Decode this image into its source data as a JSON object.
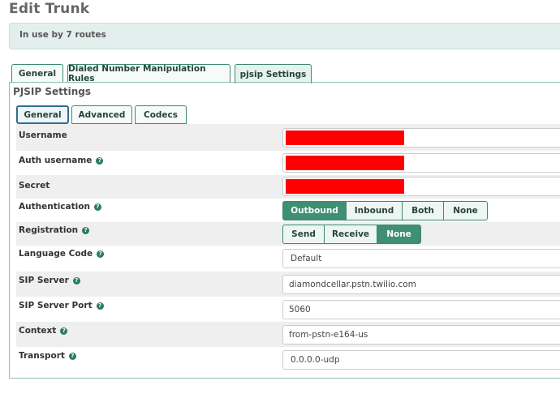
{
  "header": {
    "title": "Edit Trunk"
  },
  "info": {
    "text": "In use by 7 routes"
  },
  "tabs": [
    {
      "label": "General"
    },
    {
      "label": "Dialed Number Manipulation Rules"
    },
    {
      "label": "pjsip Settings"
    }
  ],
  "panel": {
    "heading": "PJSIP Settings",
    "subtabs": [
      {
        "label": "General"
      },
      {
        "label": "Advanced"
      },
      {
        "label": "Codecs"
      }
    ]
  },
  "form": {
    "username": {
      "label": "Username",
      "value": ""
    },
    "auth_username": {
      "label": "Auth username",
      "value": ""
    },
    "secret": {
      "label": "Secret",
      "value": ""
    },
    "authentication": {
      "label": "Authentication",
      "options": [
        "Outbound",
        "Inbound",
        "Both",
        "None"
      ],
      "selected": "Outbound"
    },
    "registration": {
      "label": "Registration",
      "options": [
        "Send",
        "Receive",
        "None"
      ],
      "selected": "None"
    },
    "language_code": {
      "label": "Language Code",
      "value": "Default"
    },
    "sip_server": {
      "label": "SIP Server",
      "value": "diamondcellar.pstn.twilio.com"
    },
    "sip_server_port": {
      "label": "SIP Server Port",
      "value": "5060"
    },
    "context": {
      "label": "Context",
      "value": "from-pstn-e164-us"
    },
    "transport": {
      "label": "Transport",
      "value": "0.0.0.0-udp"
    }
  },
  "colors": {
    "accent": "#3f8f72",
    "info_bg": "#e3efed",
    "redaction": "#ff0000"
  }
}
